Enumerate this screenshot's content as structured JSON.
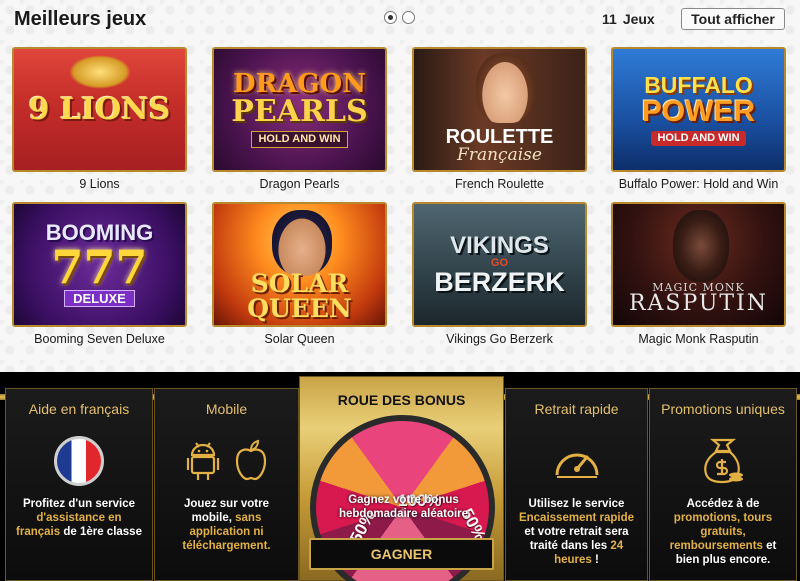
{
  "header": {
    "title": "Meilleurs jeux",
    "games_count": "11",
    "games_label": "Jeux",
    "see_all_label": "Tout afficher"
  },
  "carousel": {
    "dots": 2,
    "active_index": 0
  },
  "games": [
    {
      "name": "9 Lions",
      "art": [
        "9 LIONS"
      ]
    },
    {
      "name": "Dragon Pearls",
      "art": [
        "DRAGON",
        "PEARLS",
        "HOLD AND WIN"
      ]
    },
    {
      "name": "French Roulette",
      "art": [
        "ROULETTE",
        "Française"
      ]
    },
    {
      "name": "Buffalo Power: Hold and Win",
      "art": [
        "BUFFALO",
        "POWER",
        "HOLD AND WIN"
      ]
    },
    {
      "name": "Booming Seven Deluxe",
      "art": [
        "BOOMING",
        "777",
        "DELUXE"
      ]
    },
    {
      "name": "Solar Queen",
      "art": [
        "SOLAR QUEEN"
      ]
    },
    {
      "name": "Vikings Go Berzerk",
      "art": [
        "VIKINGS",
        "GO",
        "BERZERK"
      ]
    },
    {
      "name": "Magic Monk Rasputin",
      "art": [
        "MAGIC MONK",
        "RASPUTIN"
      ]
    }
  ],
  "features": [
    {
      "title": "Aide en français",
      "icon": "france-flag-icon",
      "desc_plain_1": "Profitez d'un service",
      "desc_hl": "d'assistance en français",
      "desc_plain_2": "de 1ère classe"
    },
    {
      "title": "Mobile",
      "icon": "android-apple-icons",
      "desc_plain_1": "Jouez sur votre mobile,",
      "desc_hl": "sans application ni",
      "desc_plain_2": "téléchargement."
    },
    {
      "title": "Retrait rapide",
      "icon": "speedometer-icon",
      "desc_plain_1": "Utilisez le service",
      "desc_hl": "Encaissement rapide",
      "desc_plain_2": "et votre retrait sera traité dans les",
      "desc_hl_2": "24 heures",
      "desc_plain_3": "!"
    },
    {
      "title": "Promotions uniques",
      "icon": "money-bag-icon",
      "desc_plain_1": "Accédez à de",
      "desc_hl": "promotions, tours gratuits, remboursements",
      "desc_plain_2": "et bien plus encore."
    }
  ],
  "bonus": {
    "title": "ROUE DES BONUS",
    "wheel_labels": [
      "100%",
      "50%",
      "50%"
    ],
    "desc": "Gagnez votre bonus hebdomadaire aléatoire",
    "button_label": "GAGNER"
  },
  "colors": {
    "accent_gold": "#e3b143",
    "thumb_border": "#b8892c",
    "dark_bg": "#000000"
  }
}
